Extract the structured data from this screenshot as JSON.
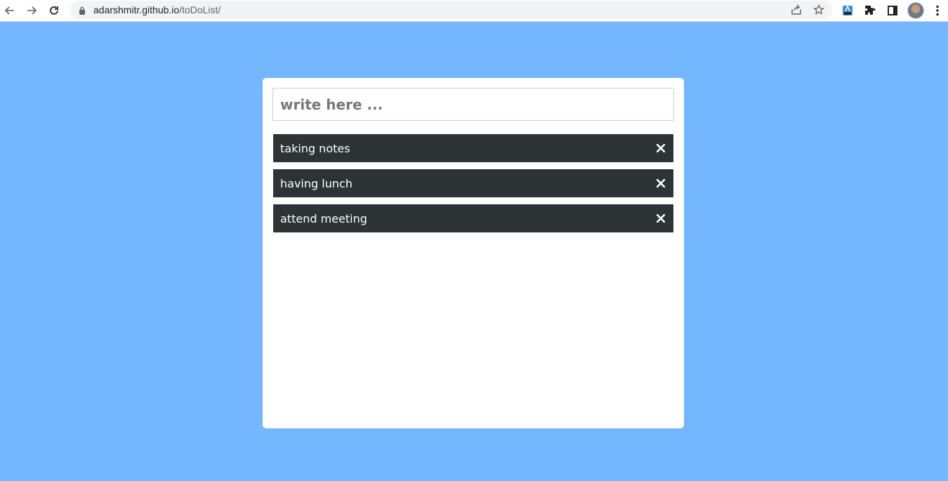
{
  "browser": {
    "url_host": "adarshmitr.github.io",
    "url_path": "/toDoList/"
  },
  "input": {
    "placeholder": "write here ...",
    "value": ""
  },
  "todos": [
    {
      "text": "taking notes"
    },
    {
      "text": "having lunch"
    },
    {
      "text": "attend meeting"
    }
  ],
  "colors": {
    "background": "#74b7fe",
    "item_bg": "#2e3436",
    "card_bg": "#ffffff"
  }
}
